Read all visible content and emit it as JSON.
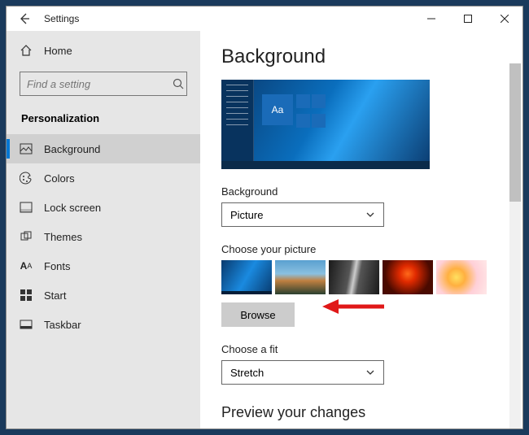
{
  "titlebar": {
    "title": "Settings"
  },
  "sidebar": {
    "home_label": "Home",
    "search_placeholder": "Find a setting",
    "category": "Personalization",
    "items": [
      {
        "label": "Background",
        "icon": "image-icon",
        "active": true
      },
      {
        "label": "Colors",
        "icon": "palette-icon"
      },
      {
        "label": "Lock screen",
        "icon": "lockscreen-icon"
      },
      {
        "label": "Themes",
        "icon": "themes-icon"
      },
      {
        "label": "Fonts",
        "icon": "fonts-icon"
      },
      {
        "label": "Start",
        "icon": "start-icon"
      },
      {
        "label": "Taskbar",
        "icon": "taskbar-icon"
      }
    ]
  },
  "main": {
    "page_title": "Background",
    "preview_tile_text": "Aa",
    "bg_label": "Background",
    "bg_select_value": "Picture",
    "choose_label": "Choose your picture",
    "browse_label": "Browse",
    "fit_label": "Choose a fit",
    "fit_select_value": "Stretch",
    "section2_title": "Preview your changes"
  }
}
